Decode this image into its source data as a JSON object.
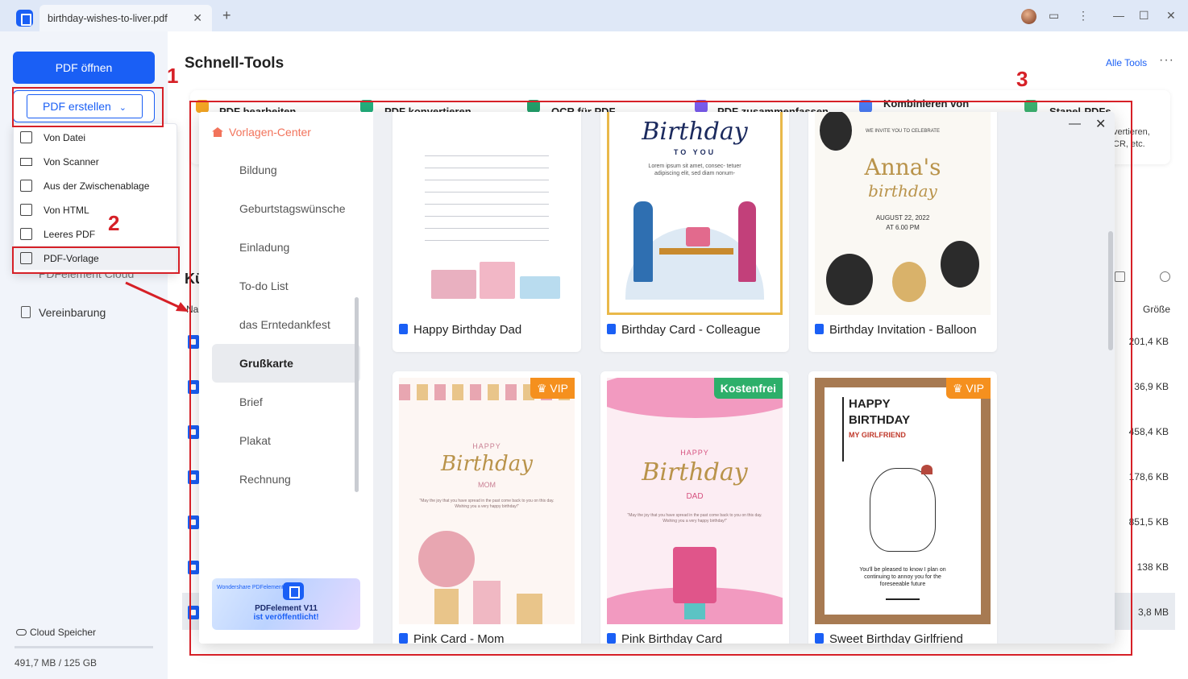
{
  "titlebar": {
    "tab_title": "birthday-wishes-to-liver.pdf",
    "tab_close": "✕",
    "add_tab": "+",
    "min": "—",
    "max": "☐",
    "close": "✕",
    "kebab": "⋮",
    "feedback": "▭"
  },
  "sidebar": {
    "open_pdf": "PDF öffnen",
    "create_pdf": "PDF erstellen",
    "create_caret": "⌄",
    "partial_item": "PDFelement Cloud",
    "agreement": "Vereinbarung",
    "cloud_storage": "Cloud Speicher",
    "storage_text": "491,7 MB / 125 GB"
  },
  "create_menu": {
    "items": [
      "Von Datei",
      "Von Scanner",
      "Aus der Zwischenablage",
      "Von HTML",
      "Leeres PDF",
      "PDF-Vorlage"
    ]
  },
  "main": {
    "title": "Schnell-Tools",
    "all_tools": "Alle Tools",
    "more": "···",
    "tools": [
      "PDF bearbeiten",
      "PDF konvertieren",
      "OCR für PDF",
      "PDF zusammenfassen",
      "Kombinieren von",
      "Stapel-PDFs"
    ],
    "right_desc_1": "vertieren,",
    "right_desc_2": "CR, etc.",
    "recent_partial": "Kü",
    "col_name_partial": "Na",
    "col_size": "Größe",
    "sizes": [
      "201,4 KB",
      "36,9 KB",
      "458,4 KB",
      "178,6 KB",
      "851,5 KB",
      "138 KB",
      "3,8 MB"
    ]
  },
  "template_center": {
    "title": "Vorlagen-Center",
    "categories": [
      "Bildung",
      "Geburtstagswünsche",
      "Einladung",
      "To-do List",
      "das Erntedankfest",
      "Grußkarte",
      "Brief",
      "Plakat",
      "Rechnung"
    ],
    "active_category": "Grußkarte",
    "promo_brand": "Wondershare PDFelement",
    "promo_line1": "PDFelement V11",
    "promo_line2": "ist veröffentlicht!",
    "minimize": "—",
    "close": "✕",
    "cards": [
      {
        "label": "Happy Birthday Dad"
      },
      {
        "label": "Birthday Card - Colleague",
        "thumb_title": "Birthday",
        "thumb_sub": "TO YOU",
        "thumb_text": "Lorem ipsum sit amet, consec- tetuer adipiscing elit, sed diam nonum-"
      },
      {
        "label": "Birthday Invitation - Balloon",
        "thumb_top": "WE INVITE YOU TO CELEBRATE",
        "thumb_name": "Anna's",
        "thumb_script": "birthday",
        "thumb_date": "AUGUST 22, 2022",
        "thumb_time": "AT 6.00 PM"
      },
      {
        "label": "Pink Card - Mom",
        "badge": "VIP",
        "thumb_happy": "HAPPY",
        "thumb_script": "Birthday",
        "thumb_mom": "MOM",
        "thumb_msg": "\"May the joy that you have spread in the past come back to you on this day. Wishing you a very happy birthday!\""
      },
      {
        "label": "Pink Birthday Card",
        "badge": "Kostenfrei",
        "thumb_happy": "HAPPY",
        "thumb_script": "Birthday",
        "thumb_dad": "DAD",
        "thumb_msg": "\"May the joy that you have spread in the past come back to you on this day. Wishing you a very happy birthday!\""
      },
      {
        "label": "Sweet Birthday Girlfriend",
        "badge": "VIP",
        "thumb_line1": "HAPPY",
        "thumb_line2": "BIRTHDAY",
        "thumb_line3": "MY GIRLFRIEND",
        "thumb_msg": "You'll be pleased to know I plan on continuing to annoy you for the foreseeable future"
      }
    ]
  },
  "annotations": {
    "n1": "1",
    "n2": "2",
    "n3": "3"
  },
  "colors": {
    "accent": "#1a5ff5",
    "annotation": "#d62027",
    "vip": "#f5901e",
    "free": "#2daf6a",
    "brand_orange": "#f2735b"
  }
}
